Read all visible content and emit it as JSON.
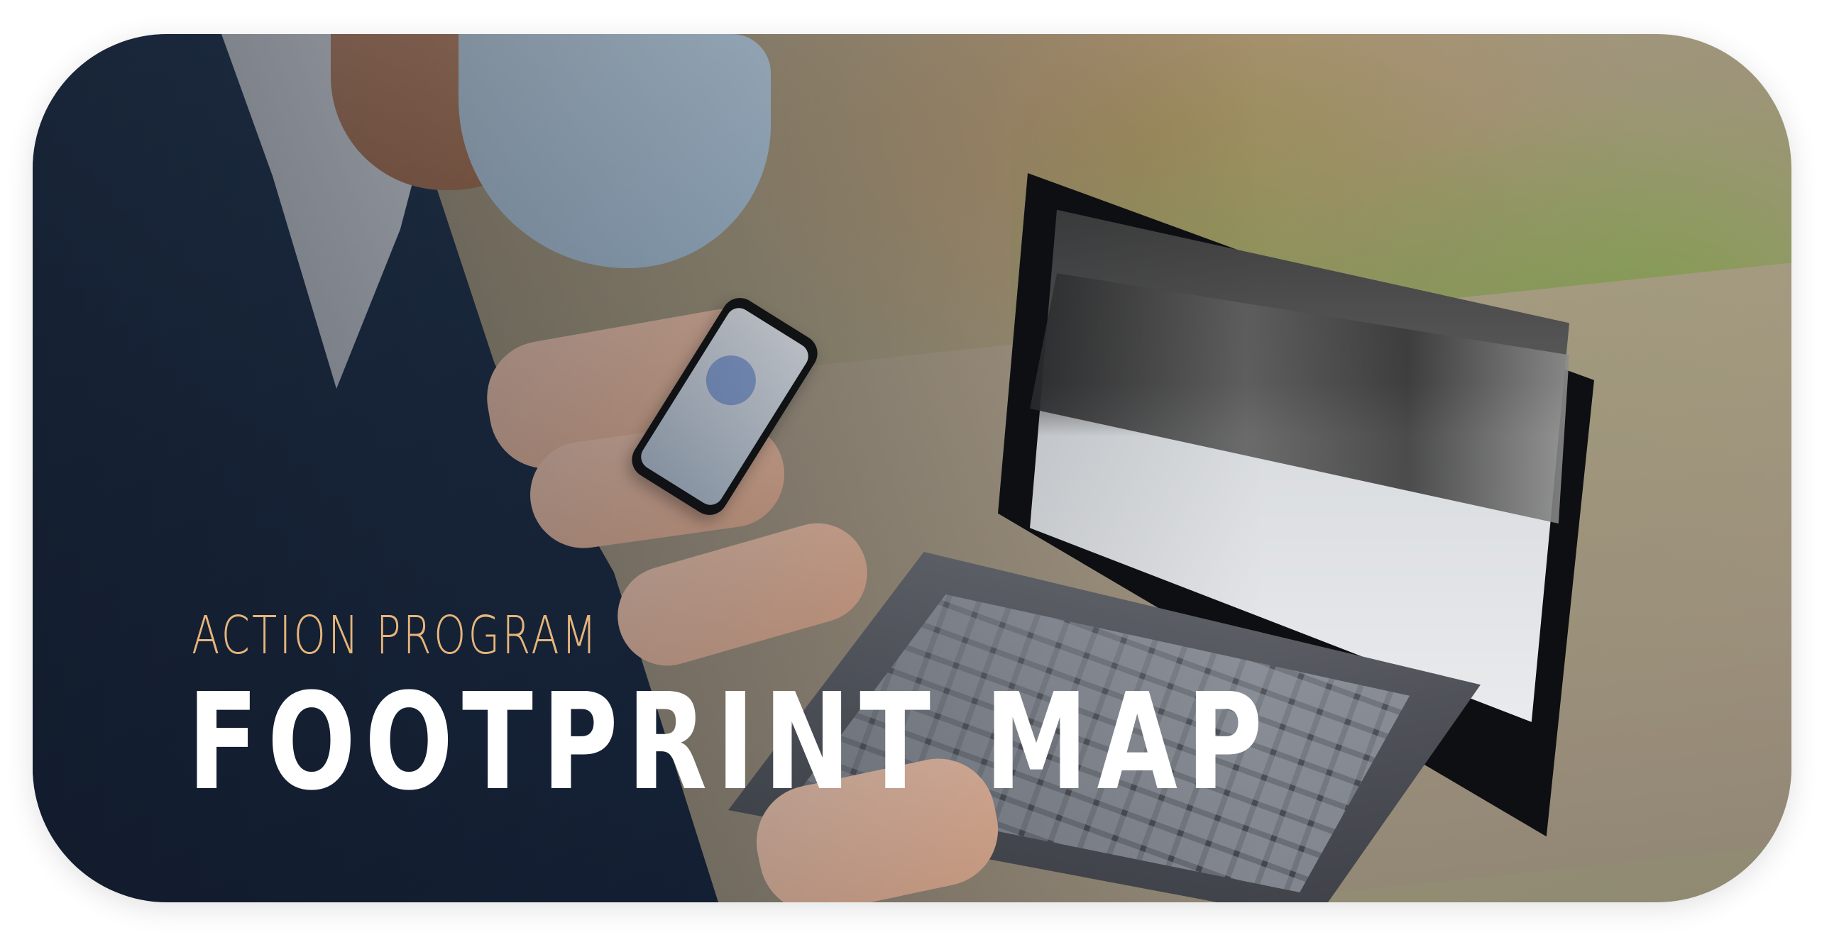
{
  "banner": {
    "eyebrow": "ACTION PROGRAM",
    "headline": "FOOTPRINT MAP"
  },
  "colors": {
    "eyebrow": "#e6b57a",
    "headline": "#ffffff",
    "background_outer": "#ffffff"
  },
  "photo": {
    "subject": "person-using-laptop-and-phone-outdoors"
  }
}
